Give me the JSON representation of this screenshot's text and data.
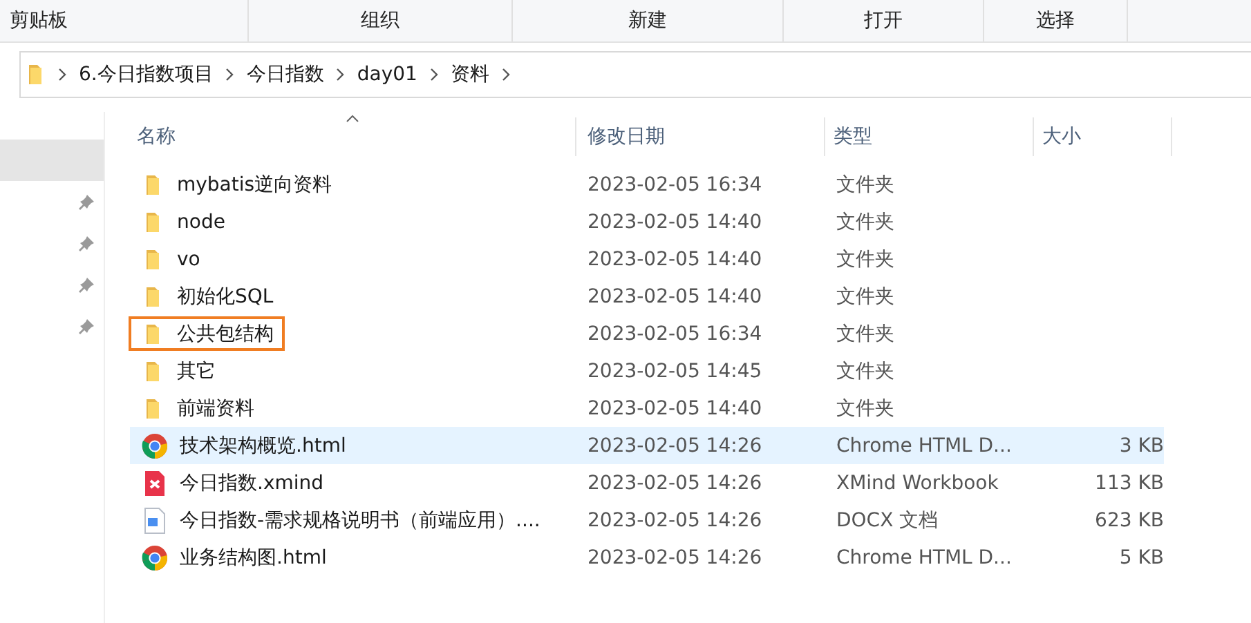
{
  "ribbon": {
    "groups": [
      {
        "label": "剪贴板"
      },
      {
        "label": "组织"
      },
      {
        "label": "新建"
      },
      {
        "label": "打开"
      },
      {
        "label": "选择"
      }
    ]
  },
  "address_bar": {
    "crumbs": [
      "6.今日指数项目",
      "今日指数",
      "day01",
      "资料"
    ]
  },
  "sidebar": {
    "items": [
      {
        "selected": true,
        "pinned": false
      },
      {
        "selected": false,
        "pinned": true
      },
      {
        "selected": false,
        "pinned": true
      },
      {
        "selected": false,
        "pinned": true
      },
      {
        "selected": false,
        "pinned": true
      }
    ]
  },
  "table": {
    "columns": [
      "名称",
      "修改日期",
      "类型",
      "大小"
    ],
    "rows": [
      {
        "kind": "folder",
        "name": "mybatis逆向资料",
        "date": "2023-02-05 16:34",
        "type": "文件夹",
        "hovered": false,
        "marked": false
      },
      {
        "kind": "folder",
        "name": "node",
        "date": "2023-02-05 14:40",
        "type": "文件夹",
        "hovered": false,
        "marked": false
      },
      {
        "kind": "folder",
        "name": "vo",
        "date": "2023-02-05 14:40",
        "type": "文件夹",
        "hovered": false,
        "marked": false
      },
      {
        "kind": "folder",
        "name": "初始化SQL",
        "date": "2023-02-05 14:40",
        "type": "文件夹",
        "hovered": false,
        "marked": false
      },
      {
        "kind": "folder",
        "name": "公共包结构",
        "date": "2023-02-05 16:34",
        "type": "文件夹",
        "hovered": false,
        "marked": true
      },
      {
        "kind": "folder",
        "name": "其它",
        "date": "2023-02-05 14:45",
        "type": "文件夹",
        "hovered": false,
        "marked": false
      },
      {
        "kind": "folder",
        "name": "前端资料",
        "date": "2023-02-05 14:40",
        "type": "文件夹",
        "hovered": false,
        "marked": false
      },
      {
        "kind": "chrome",
        "name": "技术架构概览.html",
        "date": "2023-02-05 14:26",
        "type": "Chrome HTML D...",
        "size": "3 KB",
        "hovered": true,
        "marked": false
      },
      {
        "kind": "xmind",
        "name": "今日指数.xmind",
        "date": "2023-02-05 14:26",
        "type": "XMind Workbook",
        "size": "113 KB",
        "hovered": false,
        "marked": false
      },
      {
        "kind": "docx",
        "name": "今日指数-需求规格说明书（前端应用）....",
        "date": "2023-02-05 14:26",
        "type": "DOCX 文档",
        "size": "623 KB",
        "hovered": false,
        "marked": false
      },
      {
        "kind": "chrome",
        "name": "业务结构图.html",
        "date": "2023-02-05 14:26",
        "type": "Chrome HTML D...",
        "size": "5 KB",
        "hovered": false,
        "marked": false
      }
    ]
  }
}
